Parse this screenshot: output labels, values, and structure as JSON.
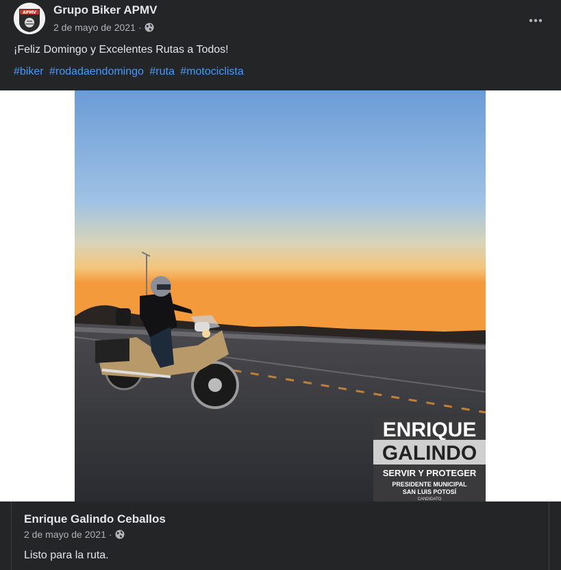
{
  "post": {
    "page_name": "Grupo Biker APMV",
    "date": "2 de mayo de 2021",
    "separator": "·",
    "privacy_icon": "globe-icon",
    "more_icon": "more-dots-icon",
    "caption": "¡Feliz Domingo y Excelentes Rutas a Todos!",
    "hashtags": [
      "#biker",
      "#rodadaendomingo",
      "#ruta",
      "#motociclista"
    ],
    "avatar_text": "APMV"
  },
  "photo": {
    "overlay_line1": "ENRIQUE",
    "overlay_line2": "GALINDO",
    "overlay_slogan": "SERVIR Y PROTEGER",
    "overlay_role1": "PRESIDENTE MUNICIPAL",
    "overlay_role2": "SAN LUIS POTOSÍ",
    "overlay_role3": "CANDIDATO"
  },
  "shared": {
    "author": "Enrique Galindo Ceballos",
    "date": "2 de mayo de 2021",
    "separator": "·",
    "privacy_icon": "globe-icon",
    "text": "Listo para la ruta."
  },
  "colors": {
    "background": "#242526",
    "text_primary": "#e4e6eb",
    "text_secondary": "#b0b3b8",
    "link": "#4599ff"
  }
}
